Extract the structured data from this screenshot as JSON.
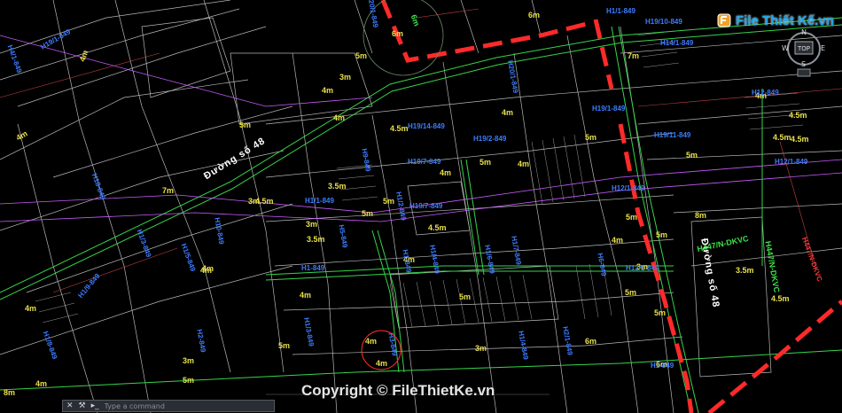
{
  "streets": [
    "Đường số 48",
    "Đường số 48"
  ],
  "dims": [
    "4m",
    "4m",
    "7m",
    "4m",
    "4m",
    "6m",
    "3m",
    "5m",
    "4m",
    "4.5m",
    "5m",
    "4m",
    "4.5m",
    "4m",
    "5m",
    "7m",
    "4m",
    "4.5m",
    "4.5m",
    "3.5m",
    "3.5m",
    "5m",
    "3m",
    "4m",
    "5m",
    "4.5m",
    "5m",
    "4m",
    "5m",
    "3m",
    "4m",
    "4m",
    "5m",
    "3.5m",
    "4m",
    "5m",
    "8m",
    "4.5m",
    "5m",
    "4m",
    "3m",
    "6m",
    "6m",
    "5m",
    "4.5m",
    "3m",
    "5m",
    "4m",
    "8m",
    "3m",
    "4m",
    "6m",
    "5m",
    "5m",
    "4m"
  ],
  "lots": [
    "H19/1-849",
    "H4/1-849",
    "H20/1-849",
    "H20/1-849",
    "H1/1-849",
    "H19/10-849",
    "H14/1-849",
    "H12-849",
    "H19/1-849",
    "H19/11-849",
    "H19/14-849",
    "H12/1-849",
    "H19/7-849",
    "H19/7-849",
    "H9-849",
    "H19/2-849",
    "H18-849",
    "H1/3-849",
    "H1/5-849",
    "H10-849",
    "H1/1-849",
    "H1-849",
    "H5-849",
    "H1/9-849",
    "H1-849",
    "H1/4-849",
    "H1/6-849",
    "H1/7-849",
    "H1/2-849",
    "H6-849",
    "H1/3-849",
    "H1/8-849",
    "H2-849",
    "H3-849",
    "H1/4-849",
    "H2/1-849",
    "H1-849",
    "H12/1-849",
    "H12/1-849"
  ],
  "green": [
    "6m",
    "H447/N-DKVC",
    "H447/N-DKVC"
  ],
  "red": [
    "H447/N-DKVC"
  ],
  "logo": {
    "text": "File Thiết Kế.vn"
  },
  "viewcube": {
    "n": "N",
    "w": "W",
    "e": "E",
    "s": "S",
    "top": "TOP"
  },
  "commandline": {
    "placeholder": "Type a command"
  },
  "copyright": "Copyright © FileThietKe.vn",
  "colors": {
    "background": "#000000",
    "lot_lines": "#e6e6e6",
    "roads": "#36d44a",
    "dimension": "#e8e04a",
    "lot_text": "#3d7cff",
    "boundary": "#ff2a2a",
    "magenta": "#c95cff"
  }
}
